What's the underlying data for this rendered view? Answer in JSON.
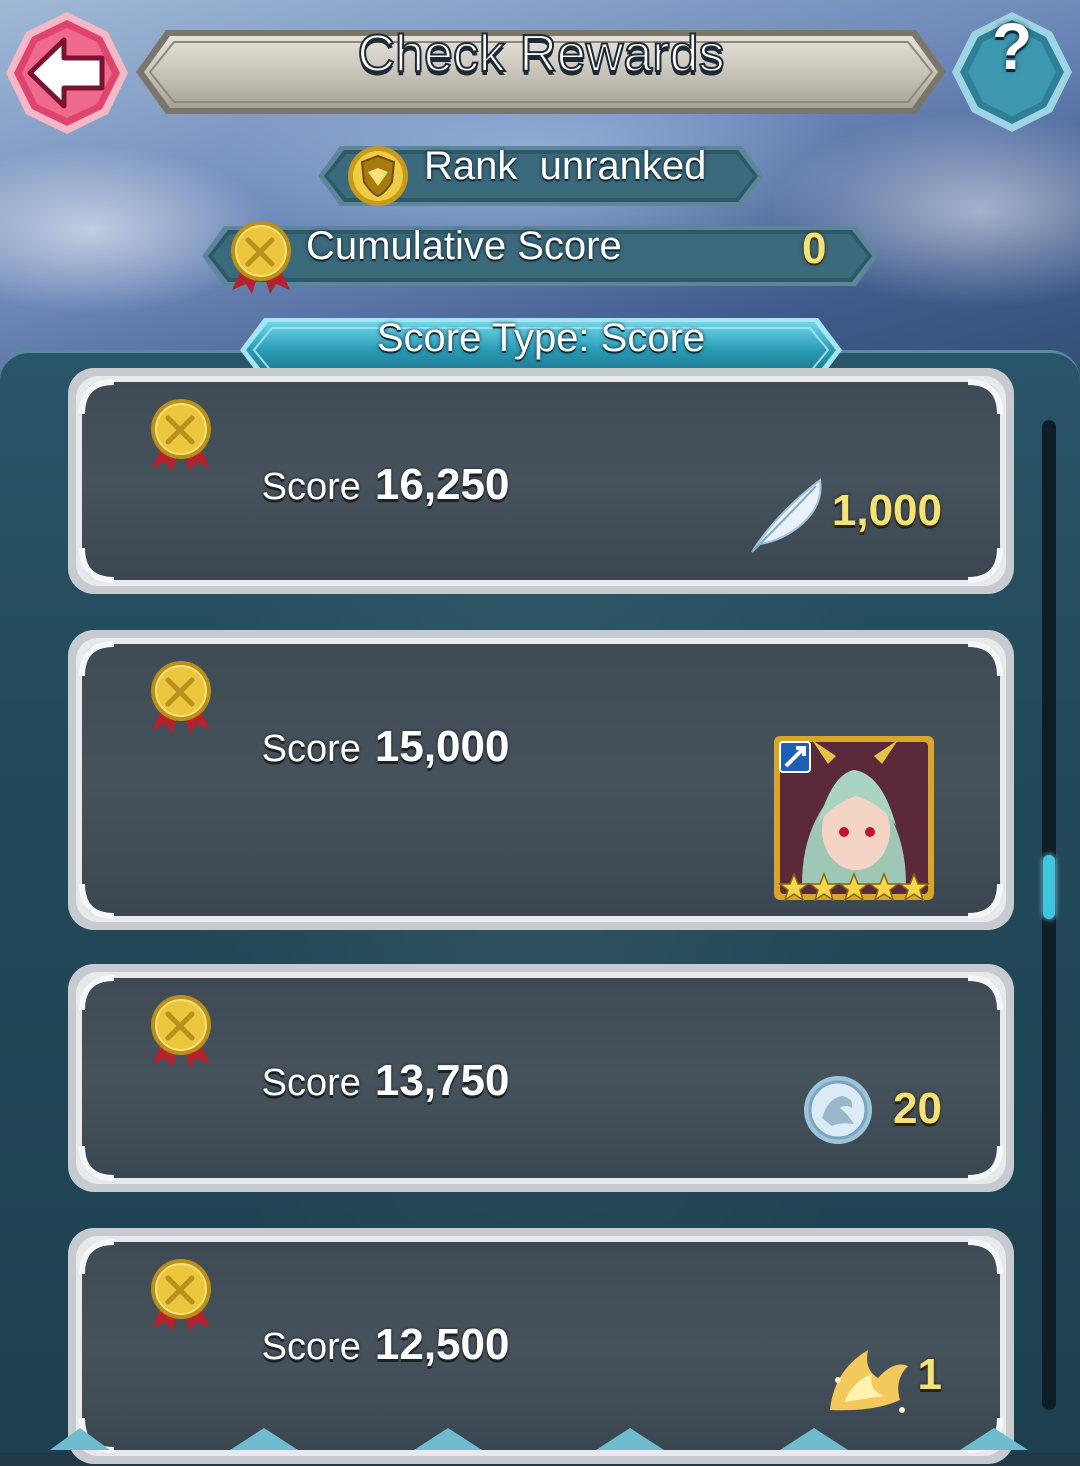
{
  "header": {
    "title": "Check Rewards",
    "back_icon": "back-arrow-icon",
    "help_label": "?"
  },
  "rank": {
    "label": "Rank  unranked",
    "icon": "rank-shield-icon"
  },
  "cumulative": {
    "label": "Cumulative Score",
    "value": "0",
    "icon": "score-medal-icon"
  },
  "score_type": {
    "label": "Score Type: Score"
  },
  "rewards": [
    {
      "score_label": "Score",
      "score_value": "16,250",
      "reward_icon": "feather-icon",
      "quantity": "1,000"
    },
    {
      "score_label": "Score",
      "score_value": "15,000",
      "reward_icon": "hero-portrait-icon",
      "quantity": ""
    },
    {
      "score_label": "Score",
      "score_value": "13,750",
      "reward_icon": "dragon-coin-icon",
      "quantity": "20"
    },
    {
      "score_label": "Score",
      "score_value": "12,500",
      "reward_icon": "dragonflower-icon",
      "quantity": "1"
    }
  ],
  "scrollbar": {
    "position_fraction": 0.47
  },
  "colors": {
    "accent_gold": "#f2e27a",
    "back_red": "#e0436e",
    "help_teal": "#2f7f96",
    "scroll_thumb": "#3ec6e0"
  }
}
